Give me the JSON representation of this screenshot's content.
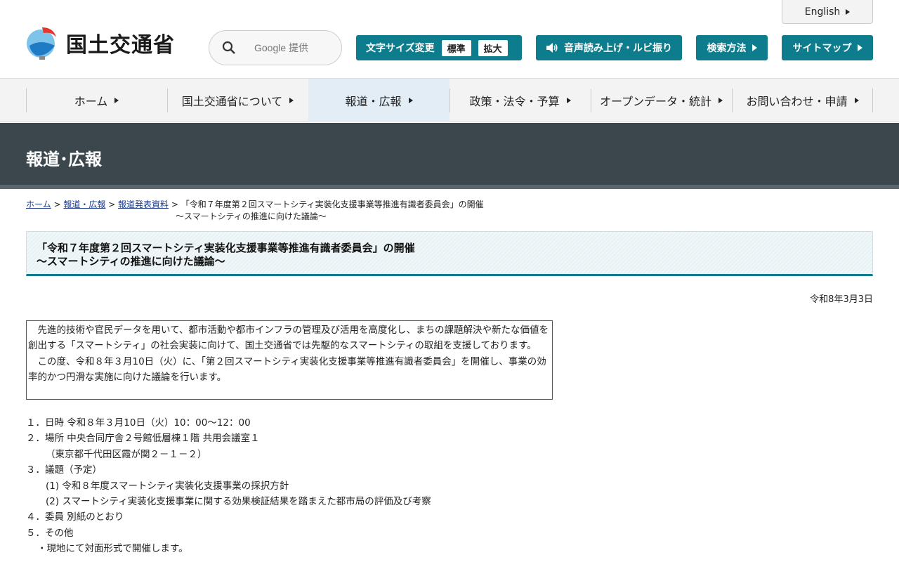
{
  "header": {
    "logo_text": "国土交通省",
    "search": {
      "placeholder": "Google 提供"
    },
    "fontsize": {
      "label": "文字サイズ変更",
      "options": [
        "標準",
        "拡大"
      ]
    },
    "speech_label": "音声読み上げ・ルビ振り",
    "search_help_label": "検索方法",
    "sitemap_label": "サイトマップ",
    "english_label": "English"
  },
  "gnav": {
    "items": [
      "ホーム",
      "国土交通省について",
      "報道・広報",
      "政策・法令・予算",
      "オープンデータ・統計",
      "お問い合わせ・申請"
    ],
    "active_index": 2
  },
  "banner": {
    "title": "報道･広報"
  },
  "breadcrumb": {
    "home": "ホーム",
    "section": "報道・広報",
    "sub": "報道発表資料",
    "current_line1": "「令和７年度第２回スマートシティ実装化支援事業等推進有識者委員会」の開催",
    "current_line2": "～スマートシティの推進に向けた議論～"
  },
  "article": {
    "title_line1": "「令和７年度第２回スマートシティ実装化支援事業等推進有識者委員会」の開催",
    "title_line2": "～スマートシティの推進に向けた議論～",
    "date": "令和8年3月3日",
    "intro_p1": "　先進的技術や官民データを用いて、都市活動や都市インフラの管理及び活用を高度化し、まちの課題解決や新たな価値を創出する「スマートシティ」の社会実装に向けて、国土交通省では先駆的なスマートシティの取組を支援しております。",
    "intro_p2": "　この度、令和８年３月10日（火）に、「第２回スマートシティ実装化支援事業等推進有識者委員会」を開催し、事業の効率的かつ円滑な実施に向けた議論を行います。",
    "items": [
      "１．日時 令和８年３月10日（火）10：00～12：00",
      "２．場所 中央合同庁舎２号館低層棟１階 共用会議室１",
      "（東京都千代田区霞が関２－１－２）",
      "３．議題（予定）",
      "(1) 令和８年度スマートシティ実装化支援事業の採択方針",
      "(2) スマートシティ実装化支援事業に関する効果検証結果を踏まえた都市局の評価及び考察",
      "４．委員 別紙のとおり",
      "５．その他",
      "・現地にて対面形式で開催します。"
    ]
  },
  "colors": {
    "teal": "#0d7c8c",
    "banner": "#3b464d",
    "nav_active": "#e2edf6"
  }
}
